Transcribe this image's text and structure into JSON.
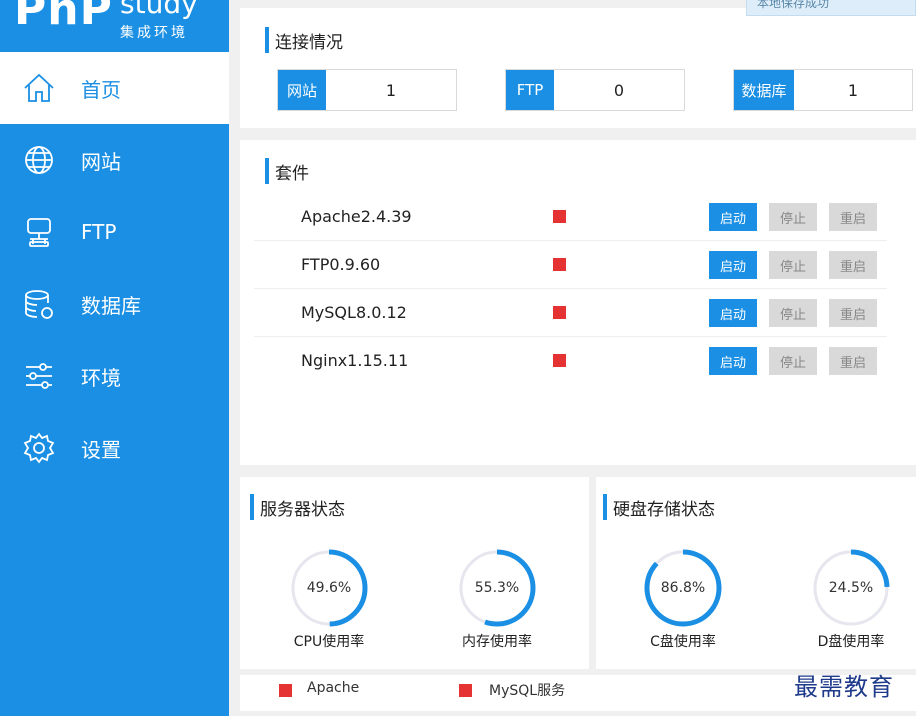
{
  "app": {
    "logo_main": "PhP",
    "logo_study": "study",
    "logo_sub": "集成环境",
    "toast_text": "本地保存成功"
  },
  "sidebar": {
    "items": [
      {
        "label": "首页",
        "icon": "home-icon",
        "active": true
      },
      {
        "label": "网站",
        "icon": "globe-icon",
        "active": false
      },
      {
        "label": "FTP",
        "icon": "server-icon",
        "active": false
      },
      {
        "label": "数据库",
        "icon": "database-icon",
        "active": false
      },
      {
        "label": "环境",
        "icon": "sliders-icon",
        "active": false
      },
      {
        "label": "设置",
        "icon": "gear-icon",
        "active": false
      }
    ]
  },
  "connections": {
    "title": "连接情况",
    "items": [
      {
        "label": "网站",
        "value": "1"
      },
      {
        "label": "FTP",
        "value": "0"
      },
      {
        "label": "数据库",
        "value": "1"
      }
    ]
  },
  "suites": {
    "title": "套件",
    "buttons": {
      "start": "启动",
      "stop": "停止",
      "restart": "重启"
    },
    "status_color": "#e53333",
    "items": [
      {
        "name": "Apache2.4.39"
      },
      {
        "name": "FTP0.9.60"
      },
      {
        "name": "MySQL8.0.12"
      },
      {
        "name": "Nginx1.15.11"
      }
    ]
  },
  "server_status": {
    "title": "服务器状态",
    "gauges": [
      {
        "value_text": "49.6%",
        "percent": 49.6,
        "label": "CPU使用率"
      },
      {
        "value_text": "55.3%",
        "percent": 55.3,
        "label": "内存使用率"
      }
    ]
  },
  "disk_status": {
    "title": "硬盘存储状态",
    "gauges": [
      {
        "value_text": "86.8%",
        "percent": 86.8,
        "label": "C盘使用率"
      },
      {
        "value_text": "24.5%",
        "percent": 24.5,
        "label": "D盘使用率"
      }
    ]
  },
  "legend": {
    "items": [
      {
        "label": "Apache"
      },
      {
        "label": "MySQL服务"
      }
    ]
  },
  "watermark": "最需教育",
  "colors": {
    "accent": "#1a8fe3",
    "stopped": "#e53333",
    "gauge_track": "#e6e6ee"
  }
}
